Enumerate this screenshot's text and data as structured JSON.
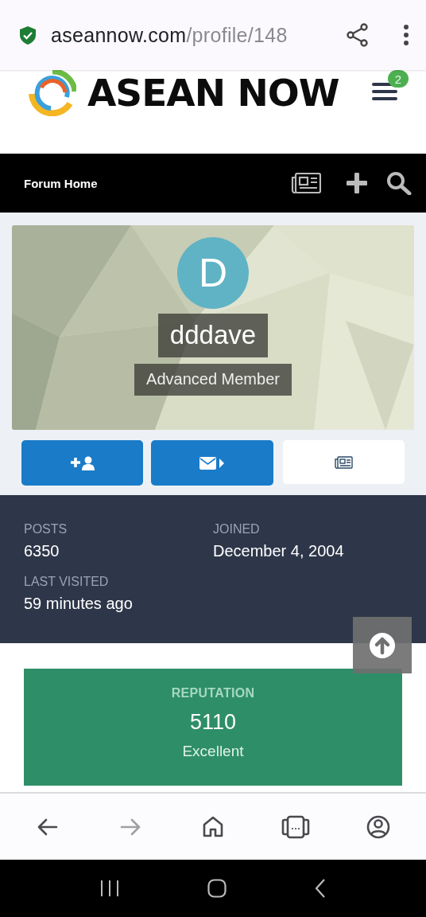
{
  "url_bar": {
    "domain": "aseannow.com",
    "path": "/profile/148"
  },
  "site_header": {
    "logo_text": "ASEAN NOW",
    "notification_count": "2"
  },
  "nav_bar": {
    "label": "Forum Home"
  },
  "profile": {
    "initial": "D",
    "username": "dddave",
    "rank": "Advanced Member",
    "action_buttons": [
      {
        "kind": "follow"
      },
      {
        "kind": "message"
      },
      {
        "kind": "activity"
      }
    ]
  },
  "stats": [
    {
      "label": "POSTS",
      "value": "6350"
    },
    {
      "label": "JOINED",
      "value": "December 4, 2004"
    },
    {
      "label": "LAST VISITED",
      "value": "59 minutes ago"
    }
  ],
  "reputation": {
    "label": "REPUTATION",
    "value": "5110",
    "rating": "Excellent"
  },
  "browser_toolbar": [
    {
      "kind": "back",
      "disabled": false
    },
    {
      "kind": "forward",
      "disabled": true
    },
    {
      "kind": "home",
      "disabled": false
    },
    {
      "kind": "tabs",
      "disabled": false
    },
    {
      "kind": "account",
      "disabled": false
    }
  ]
}
